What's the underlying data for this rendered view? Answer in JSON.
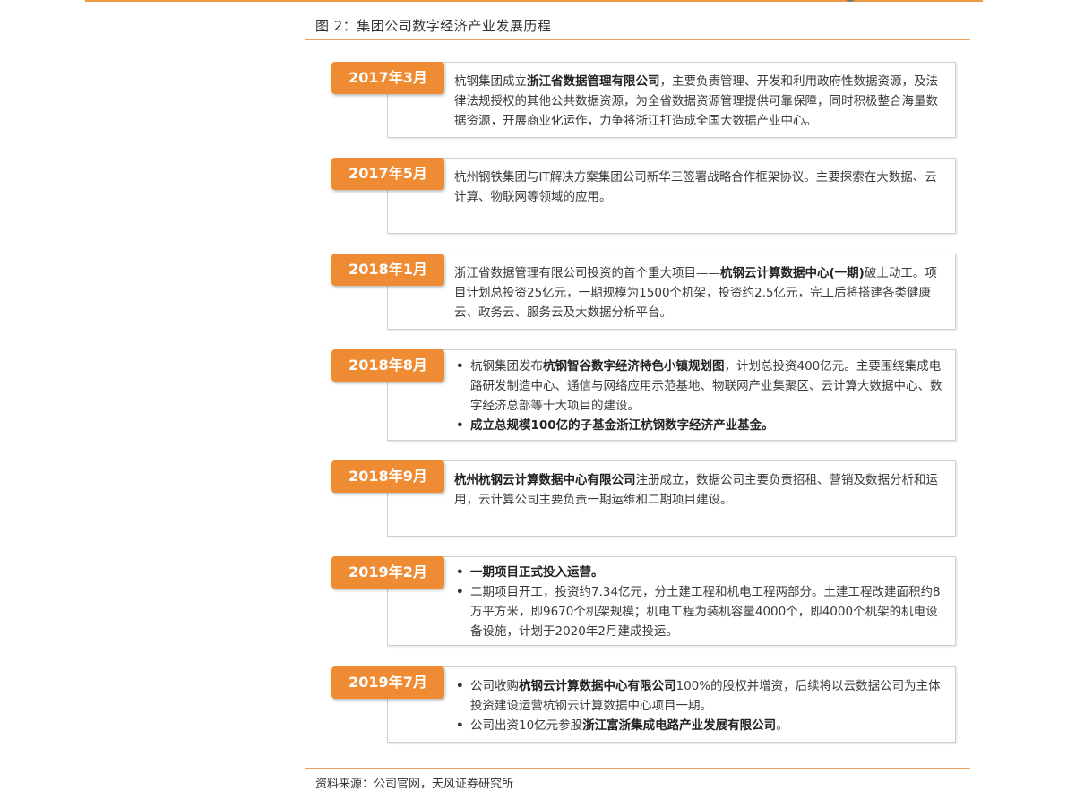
{
  "figure": {
    "title": "图 2：集团公司数字经济产业发展历程"
  },
  "timeline": [
    {
      "date": "2017年3月",
      "paragraph": [
        {
          "t": "杭钢集团成立"
        },
        {
          "t": "浙江省数据管理有限公司",
          "b": true
        },
        {
          "t": "，主要负责管理、开发和利用政府性数据资源，及法律法规授权的其他公共数据资源，为全省数据资源管理提供可靠保障，同时积极整合海量数据资源，开展商业化运作，力争将浙江打造成全国大数据产业中心。"
        }
      ]
    },
    {
      "date": "2017年5月",
      "paragraph": [
        {
          "t": "杭州钢铁集团与IT解决方案集团公司新华三签署战略合作框架协议。主要探索在大数据、云计算、物联网等领域的应用。"
        }
      ]
    },
    {
      "date": "2018年1月",
      "paragraph": [
        {
          "t": "浙江省数据管理有限公司投资的首个重大项目——"
        },
        {
          "t": "杭钢云计算数据中心(一期)",
          "b": true
        },
        {
          "t": "破土动工。项目计划总投资25亿元，一期规模为1500个机架，投资约2.5亿元，完工后将搭建各类健康云、政务云、服务云及大数据分析平台。"
        }
      ]
    },
    {
      "date": "2018年8月",
      "bullets": [
        [
          {
            "t": "杭钢集团发布"
          },
          {
            "t": "杭钢智谷数字经济特色小镇规划图",
            "b": true
          },
          {
            "t": "，计划总投资400亿元。主要围绕集成电路研发制造中心、通信与网络应用示范基地、物联网产业集聚区、云计算大数据中心、数字经济总部等十大项目的建设。"
          }
        ],
        [
          {
            "t": "成立总规模100亿的子基金浙江杭钢数字经济产业基金。",
            "b": true
          }
        ]
      ]
    },
    {
      "date": "2018年9月",
      "paragraph": [
        {
          "t": "杭州杭钢云计算数据中心有限公司",
          "b": true
        },
        {
          "t": "注册成立，数据公司主要负责招租、营销及数据分析和运用，云计算公司主要负责一期运维和二期项目建设。"
        }
      ]
    },
    {
      "date": "2019年2月",
      "bullets": [
        [
          {
            "t": "一期项目正式投入运营。",
            "b": true
          }
        ],
        [
          {
            "t": "二期项目开工，投资约7.34亿元，分土建工程和机电工程两部分。土建工程改建面积约8万平方米，即9670个机架规模；机电工程为装机容量4000个，即4000个机架的机电设备设施，计划于2020年2月建成投运。"
          }
        ]
      ]
    },
    {
      "date": "2019年7月",
      "bullets": [
        [
          {
            "t": "公司收购"
          },
          {
            "t": "杭钢云计算数据中心有限公司",
            "b": true
          },
          {
            "t": "100%的股权并增资，后续将以云数据公司为主体投资建设运营杭钢云计算数据中心项目一期。"
          }
        ],
        [
          {
            "t": "公司出资10亿元参股"
          },
          {
            "t": "浙江富浙集成电路产业发展有限公司",
            "b": true
          },
          {
            "t": "。"
          }
        ]
      ]
    }
  ],
  "source": "资料来源：公司官网，天风证券研究所",
  "colors": {
    "accent": "#ef8b33",
    "rule": "#f0a25a",
    "box_border": "#cfcfcf"
  }
}
